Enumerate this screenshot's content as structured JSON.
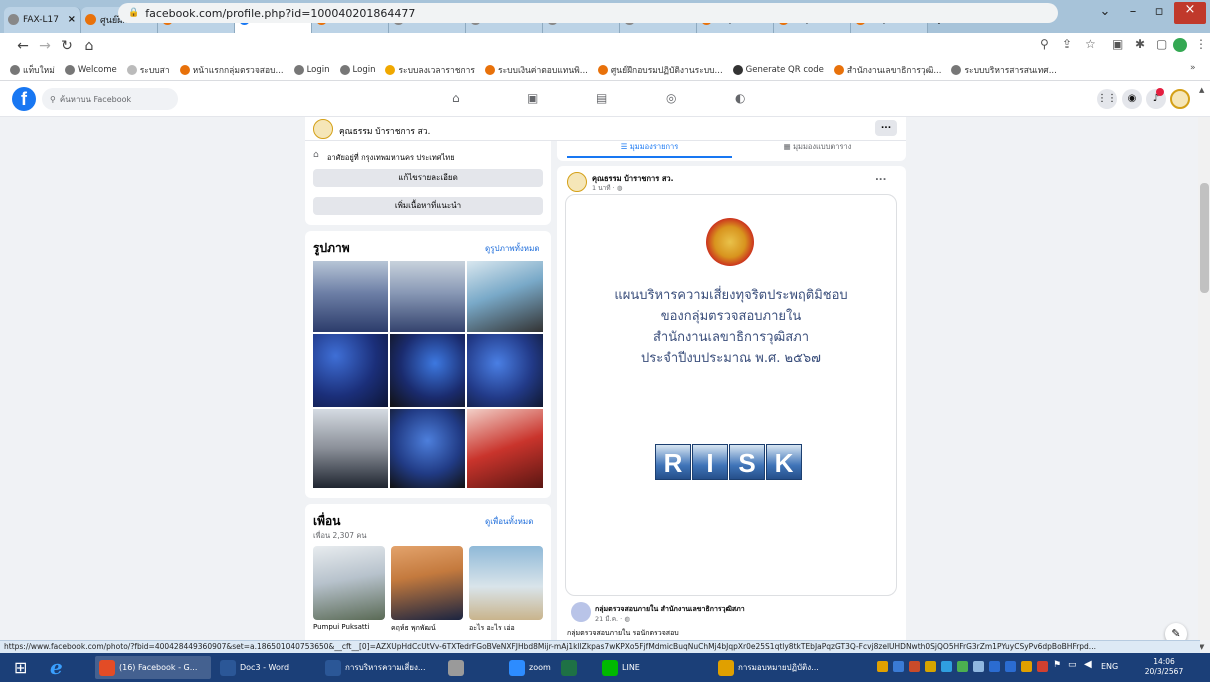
{
  "browser": {
    "tabs": [
      {
        "label": "FAX-L17",
        "color": "#888888"
      },
      {
        "label": "ศูนย์ฝึกอบ",
        "color": "#e8710a"
      },
      {
        "label": "รายวิชา",
        "color": "#e8710a"
      },
      {
        "label": "(16) Face",
        "color": "#1877f2",
        "active": true
      },
      {
        "label": "หน้าหลัก",
        "color": "#e8710a"
      },
      {
        "label": "SmartCh",
        "color": "#888888"
      },
      {
        "label": "SmartCh",
        "color": "#888888"
      },
      {
        "label": "SmartCh",
        "color": "#888888"
      },
      {
        "label": "SmartCh",
        "color": "#888888"
      },
      {
        "label": "https://",
        "color": "#e8710a"
      },
      {
        "label": "https://",
        "color": "#e8710a"
      },
      {
        "label": "https://",
        "color": "#e8710a"
      }
    ],
    "new_tab": "+",
    "window_controls": {
      "minimize": "–",
      "restore": "▫",
      "close": "×"
    },
    "url": "facebook.com/profile.php?id=100040201864477",
    "bookmarks": [
      {
        "label": "แท็บใหม่",
        "color": "#777777"
      },
      {
        "label": "Welcome",
        "color": "#777777"
      },
      {
        "label": "ระบบสา",
        "color": "#bbbbbb"
      },
      {
        "label": "หน้าแรกกลุ่มตรวจสอบ...",
        "color": "#e8710a"
      },
      {
        "label": "Login",
        "color": "#777777"
      },
      {
        "label": "Login",
        "color": "#777777"
      },
      {
        "label": "ระบบลงเวลาราชการ",
        "color": "#f0a800"
      },
      {
        "label": "ระบบเงินค่าตอบแทนพิ...",
        "color": "#e8710a"
      },
      {
        "label": "ศูนย์ฝึกอบรมปฏิบัติงานระบบ...",
        "color": "#e8710a"
      },
      {
        "label": "Generate QR code",
        "color": "#333333"
      },
      {
        "label": "สำนักงานเลขาธิการวุฒิ...",
        "color": "#e8710a"
      },
      {
        "label": "ระบบบริหารสารสนเทศ...",
        "color": "#777777"
      }
    ],
    "bookmarks_more": "»"
  },
  "facebook": {
    "search_placeholder": "ค้นหาบน Facebook",
    "sticky_name": "คุณธรรม บ้าราชการ สว.",
    "sticky_more": "...",
    "intro_line": "อาศัยอยู่ที่ กรุงเทพมหานคร ประเทศไทย",
    "edit_details": "แก้ไขรายละเอียด",
    "add_featured": "เพิ่มเนื้อหาที่แนะนำ",
    "photos_title": "รูปภาพ",
    "photos_link": "ดูรูปภาพทั้งหมด",
    "friends_title": "เพื่อน",
    "friends_link": "ดูเพื่อนทั้งหมด",
    "friends_count": "เพื่อน 2,307 คน",
    "friends": [
      {
        "name": "Pumpui Puksatti"
      },
      {
        "name": "คฤห์ธ พุกพัฒน์"
      },
      {
        "name": "อะไร อะไร เอ่อ"
      }
    ],
    "view_tabs": {
      "list": "มุมมองรายการ",
      "grid": "มุมมองแบบตาราง"
    },
    "post": {
      "author": "คุณธรรม บ้าราชการ สว.",
      "time": "1 นาที · ",
      "more": "...",
      "doc_lines": [
        "แผนบริหารความเสี่ยงทุจริตประพฤติมิชอบ",
        "ของกลุ่มตรวจสอบภายใน",
        "สำนักงานเลขาธิการวุฒิสภา",
        "ประจำปีงบประมาณ พ.ศ. ๒๕๖๗"
      ],
      "risk_letters": [
        "R",
        "I",
        "S",
        "K"
      ],
      "shared_author": "กลุ่มตรวจสอบภายใน สำนักงานเลขาธิการวุฒิสภา",
      "shared_time": "21 มี.ค. · ",
      "shared_text": "กลุ่มตรวจสอบภายใน รอนักตรวจสอบ"
    }
  },
  "statusbar_url": "https://www.facebook.com/photo/?fbid=400428449360907&set=a.186501040753650&__cft__[0]=AZXUpHdCcUtVv-6TXTedrFGoBVeNXFJHbd8Mijr-mAj1kllZkpas7wKPXo5FjfMdmicBuqNuChMj4bJqpXr0e25S1qtly8tkTEbJaPqzGT3Q-Fcvj8zelUHDNwth0SjQO5HFrG3rZm1PYuyCSyPv6dpBoBHFrpd...",
  "taskbar": {
    "items": [
      {
        "label": "(16) Facebook - G...",
        "color": "#e34c26"
      },
      {
        "label": "Doc3 - Word",
        "color": "#2b5797"
      },
      {
        "label": "การบริหารความเสี่ยง...",
        "color": "#2b5797"
      },
      {
        "label": "",
        "color": "#9a9a9a"
      },
      {
        "label": "zoom",
        "color": "#2d8cff"
      },
      {
        "label": "",
        "color": "#1e7145"
      },
      {
        "label": "LINE",
        "color": "#00b900"
      },
      {
        "label": "การมอบหมายปฏิบัติง...",
        "color": "#e0a000"
      }
    ],
    "lang": "ENG",
    "time": "14:06",
    "date": "20/3/2567"
  },
  "colors": {
    "facebook_blue": "#1877f2",
    "link_blue": "#216fdb",
    "tab_bar": "#a7c3d9",
    "taskbar": "#1b3f78"
  }
}
